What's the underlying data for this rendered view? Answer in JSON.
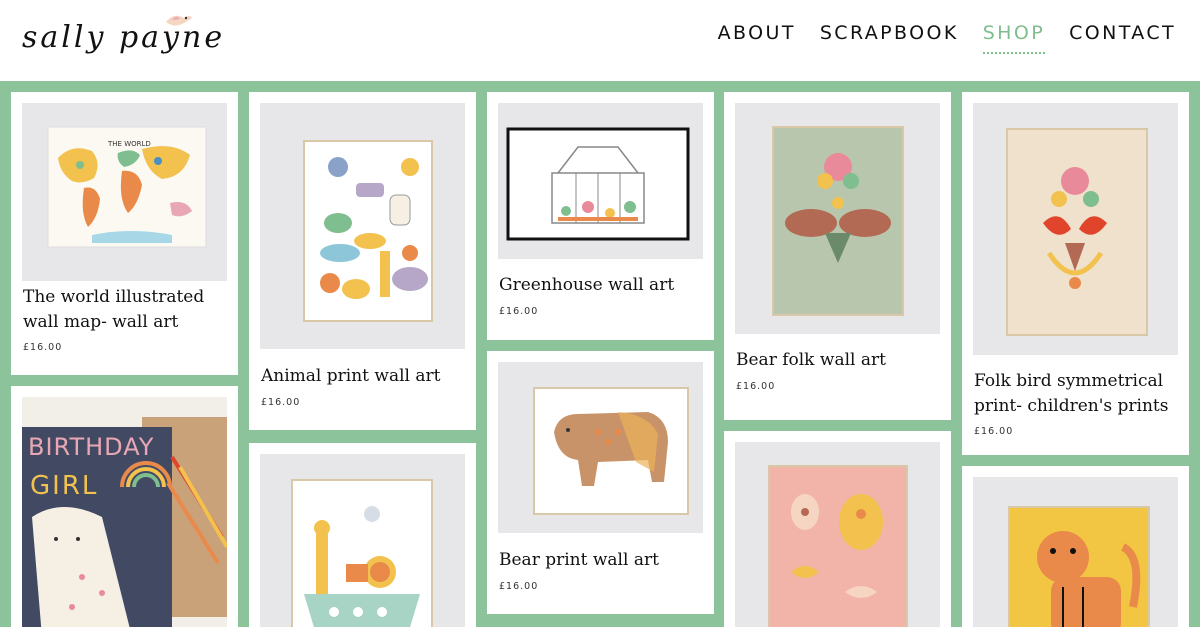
{
  "brand": {
    "name": "sally payne"
  },
  "nav": {
    "items": [
      {
        "label": "ABOUT"
      },
      {
        "label": "SCRAPBOOK"
      },
      {
        "label": "SHOP"
      },
      {
        "label": "CONTACT"
      }
    ],
    "active": "SHOP"
  },
  "colors": {
    "background": "#8cc39a",
    "accent": "#7fbe8e",
    "card": "#ffffff"
  },
  "products": [
    {
      "title_line1": "The world illustrated",
      "title_line2": "wall map- wall art",
      "price": "£16.00"
    },
    {
      "title_line1": "Animal print wall art",
      "price": "£16.00"
    },
    {
      "title_line1": "Greenhouse wall art",
      "price": "£16.00"
    },
    {
      "title_line1": "Bear folk wall art",
      "price": "£16.00"
    },
    {
      "title_line1": "Folk bird symmetrical",
      "title_line2": "print- children's prints",
      "price": "£16.00"
    },
    {
      "title_line1": "Bear print wall art",
      "price": "£16.00"
    }
  ],
  "artwork_text": {
    "birthday_line1": "BIRTHDAY",
    "birthday_line2": "GIRL",
    "map_title": "THE WORLD"
  }
}
